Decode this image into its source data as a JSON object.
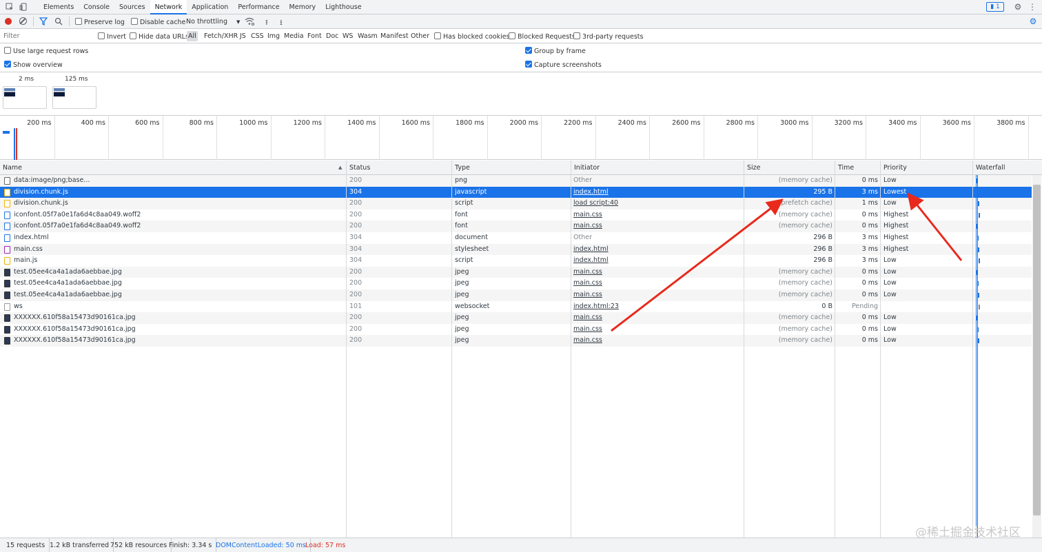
{
  "tabs": [
    "Elements",
    "Console",
    "Sources",
    "Network",
    "Application",
    "Performance",
    "Memory",
    "Lighthouse"
  ],
  "active_tab": "Network",
  "messages_badge": "1",
  "toolbar": {
    "preserve_log": "Preserve log",
    "disable_cache": "Disable cache",
    "throttling": "No throttling"
  },
  "filter": {
    "placeholder": "Filter",
    "invert": "Invert",
    "hide_data_urls": "Hide data URLs",
    "types": [
      "All",
      "Fetch/XHR",
      "JS",
      "CSS",
      "Img",
      "Media",
      "Font",
      "Doc",
      "WS",
      "Wasm",
      "Manifest",
      "Other"
    ],
    "has_blocked_cookies": "Has blocked cookies",
    "blocked_requests": "Blocked Requests",
    "third_party": "3rd-party requests"
  },
  "settings": {
    "large_rows": "Use large request rows",
    "show_overview": "Show overview",
    "group_by_frame": "Group by frame",
    "capture_screenshots": "Capture screenshots"
  },
  "screenshots": [
    "2 ms",
    "125 ms"
  ],
  "timeline_ticks": [
    "200 ms",
    "400 ms",
    "600 ms",
    "800 ms",
    "1000 ms",
    "1200 ms",
    "1400 ms",
    "1600 ms",
    "1800 ms",
    "2000 ms",
    "2200 ms",
    "2400 ms",
    "2600 ms",
    "2800 ms",
    "3000 ms",
    "3200 ms",
    "3400 ms",
    "3600 ms",
    "3800 ms"
  ],
  "columns": {
    "name": "Name",
    "status": "Status",
    "type": "Type",
    "initiator": "Initiator",
    "size": "Size",
    "time": "Time",
    "priority": "Priority",
    "waterfall": "Waterfall"
  },
  "requests": [
    {
      "name": "data:image/png;base...",
      "status": "200",
      "type": "png",
      "initiator": "Other",
      "initiator_link": false,
      "size": "(memory cache)",
      "time": "0 ms",
      "priority": "Low"
    },
    {
      "name": "division.chunk.js",
      "status": "304",
      "type": "javascript",
      "initiator": "index.html",
      "initiator_link": true,
      "size": "295 B",
      "time": "3 ms",
      "priority": "Lowest"
    },
    {
      "name": "division.chunk.js",
      "status": "200",
      "type": "script",
      "initiator": "load script:40",
      "initiator_link": true,
      "size": "(prefetch cache)",
      "time": "1 ms",
      "priority": "Low"
    },
    {
      "name": "iconfont.05f7a0e1fa6d4c8aa049.woff2",
      "status": "200",
      "type": "font",
      "initiator": "main.css",
      "initiator_link": true,
      "size": "(memory cache)",
      "time": "0 ms",
      "priority": "Highest"
    },
    {
      "name": "iconfont.05f7a0e1fa6d4c8aa049.woff2",
      "status": "200",
      "type": "font",
      "initiator": "main.css",
      "initiator_link": true,
      "size": "(memory cache)",
      "time": "0 ms",
      "priority": "Highest"
    },
    {
      "name": "index.html",
      "status": "304",
      "type": "document",
      "initiator": "Other",
      "initiator_link": false,
      "size": "296 B",
      "time": "3 ms",
      "priority": "Highest"
    },
    {
      "name": "main.css",
      "status": "304",
      "type": "stylesheet",
      "initiator": "index.html",
      "initiator_link": true,
      "size": "296 B",
      "time": "3 ms",
      "priority": "Highest"
    },
    {
      "name": "main.js",
      "status": "304",
      "type": "script",
      "initiator": "index.html",
      "initiator_link": true,
      "size": "296 B",
      "time": "3 ms",
      "priority": "Low"
    },
    {
      "name": "test.05ee4ca4a1ada6aebbae.jpg",
      "status": "200",
      "type": "jpeg",
      "initiator": "main.css",
      "initiator_link": true,
      "size": "(memory cache)",
      "time": "0 ms",
      "priority": "Low"
    },
    {
      "name": "test.05ee4ca4a1ada6aebbae.jpg",
      "status": "200",
      "type": "jpeg",
      "initiator": "main.css",
      "initiator_link": true,
      "size": "(memory cache)",
      "time": "0 ms",
      "priority": "Low"
    },
    {
      "name": "test.05ee4ca4a1ada6aebbae.jpg",
      "status": "200",
      "type": "jpeg",
      "initiator": "main.css",
      "initiator_link": true,
      "size": "(memory cache)",
      "time": "0 ms",
      "priority": "Low"
    },
    {
      "name": "ws",
      "status": "101",
      "type": "websocket",
      "initiator": "index.html:23",
      "initiator_link": true,
      "size": "0 B",
      "time": "Pending",
      "priority": ""
    },
    {
      "name": "XXXXXX.610f58a15473d90161ca.jpg",
      "status": "200",
      "type": "jpeg",
      "initiator": "main.css",
      "initiator_link": true,
      "size": "(memory cache)",
      "time": "0 ms",
      "priority": "Low"
    },
    {
      "name": "XXXXXX.610f58a15473d90161ca.jpg",
      "status": "200",
      "type": "jpeg",
      "initiator": "main.css",
      "initiator_link": true,
      "size": "(memory cache)",
      "time": "0 ms",
      "priority": "Low"
    },
    {
      "name": "XXXXXX.610f58a15473d90161ca.jpg",
      "status": "200",
      "type": "jpeg",
      "initiator": "main.css",
      "initiator_link": true,
      "size": "(memory cache)",
      "time": "0 ms",
      "priority": "Low"
    }
  ],
  "selected_row": 1,
  "status_bar": {
    "requests": "15 requests",
    "transferred": "1.2 kB transferred",
    "resources": "752 kB resources",
    "finish": "Finish: 3.34 s",
    "dom_content_loaded": "DOMContentLoaded: 50 ms",
    "load": "Load: 57 ms"
  },
  "watermark": "@稀土掘金技术社区",
  "colors": {
    "accent": "#1a73e8",
    "record": "#d93025",
    "dcl": "#1a73e8",
    "load": "#d93025",
    "annotation_arrow": "#e8291c"
  }
}
